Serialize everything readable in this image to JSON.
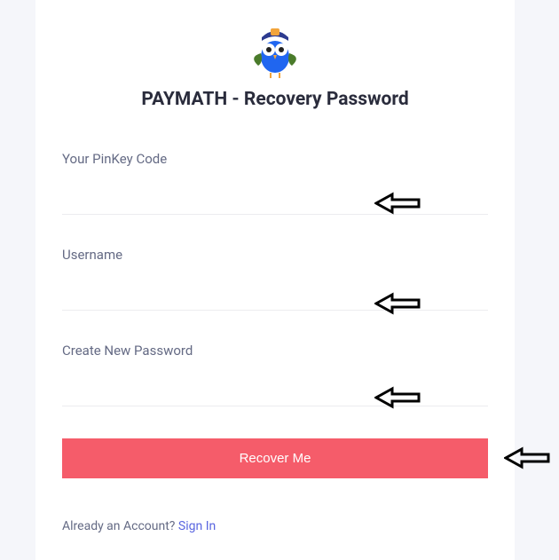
{
  "title": "PAYMATH - Recovery Password",
  "fields": {
    "pinkey": {
      "label": "Your PinKey Code",
      "value": ""
    },
    "username": {
      "label": "Username",
      "value": ""
    },
    "newpassword": {
      "label": "Create New Password",
      "value": ""
    }
  },
  "button": {
    "recover": "Recover Me"
  },
  "footer": {
    "already_text": "Already an Account? ",
    "signin": "Sign In"
  }
}
